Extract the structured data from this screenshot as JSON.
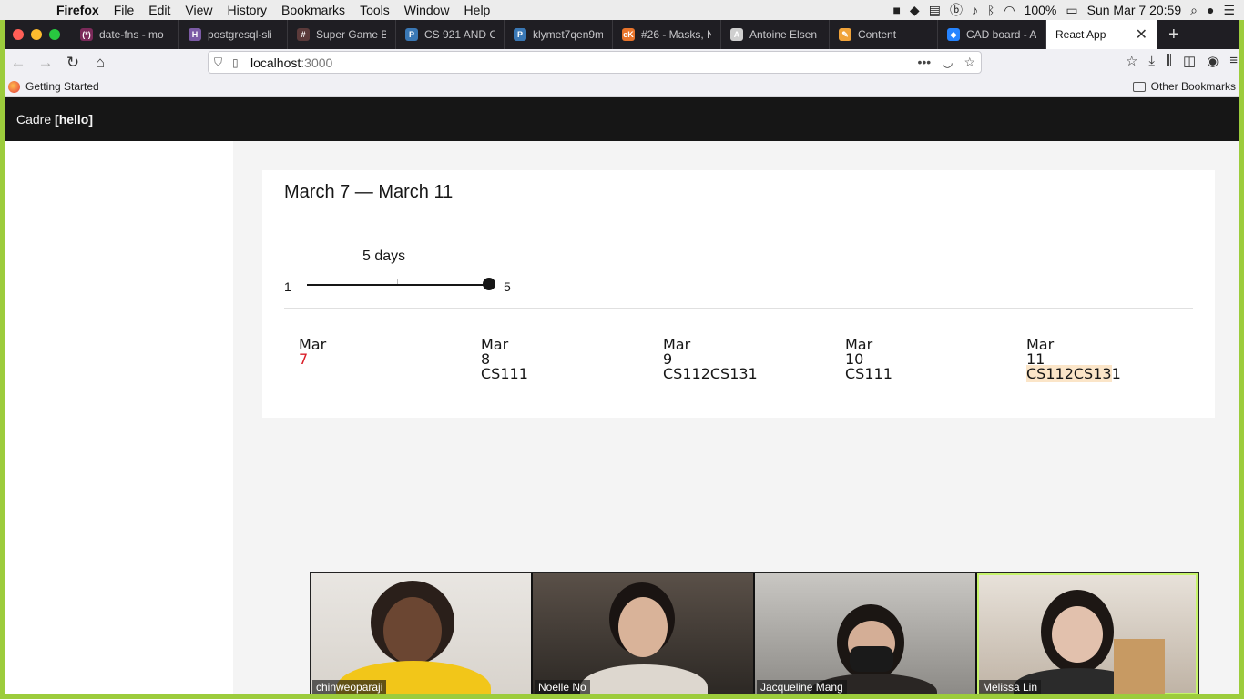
{
  "menubar": {
    "items": [
      "Firefox",
      "File",
      "Edit",
      "View",
      "History",
      "Bookmarks",
      "Tools",
      "Window",
      "Help"
    ],
    "battery": "100%",
    "clock": "Sun Mar 7  20:59"
  },
  "tabs": [
    {
      "label": "date-fns - mo",
      "icon": "date-fns-icon",
      "color": "#7b2a5a",
      "glyph": "(*)"
    },
    {
      "label": "postgresql-sli",
      "icon": "heroku-icon",
      "color": "#7c5ba6",
      "glyph": "H"
    },
    {
      "label": "Super Game B",
      "icon": "game-icon",
      "color": "#5b3a3a",
      "glyph": "#"
    },
    {
      "label": "CS 921 AND C",
      "icon": "piazza-icon",
      "color": "#3a78b5",
      "glyph": "P"
    },
    {
      "label": "klymet7qen9m",
      "icon": "piazza-icon",
      "color": "#3a78b5",
      "glyph": "P"
    },
    {
      "label": "#26 - Masks, N",
      "icon": "tab-orange-icon",
      "color": "#e8742b",
      "glyph": "eK"
    },
    {
      "label": "Antoine Elsen",
      "icon": "profile-icon",
      "color": "#cfcfcf",
      "glyph": "A"
    },
    {
      "label": "Content",
      "icon": "pencil-icon",
      "color": "#f0a33a",
      "glyph": "✎"
    },
    {
      "label": "CAD board - A",
      "icon": "jira-icon",
      "color": "#2684ff",
      "glyph": "◆"
    }
  ],
  "active_tab": {
    "label": "React App"
  },
  "url": {
    "host": "localhost",
    "port": ":3000"
  },
  "bookmarks": {
    "getting_started": "Getting Started",
    "other": "Other Bookmarks"
  },
  "app": {
    "brand": "Cadre",
    "brand_bold": "[hello]",
    "title": "March 7 — March 11",
    "slider": {
      "label": "5 days",
      "min": "1",
      "max": "5",
      "value": 5
    },
    "days": [
      {
        "month": "Mar",
        "num": "7",
        "courses": "",
        "today": true
      },
      {
        "month": "Mar",
        "num": "8",
        "courses": "CS111"
      },
      {
        "month": "Mar",
        "num": "9",
        "courses": "CS112CS131"
      },
      {
        "month": "Mar",
        "num": "10",
        "courses": "CS111"
      },
      {
        "month": "Mar",
        "num": "11",
        "courses_hl": "CS112CS13",
        "courses_rest": "1"
      }
    ]
  },
  "video": {
    "participants": [
      "chinweoparaji",
      "Noelle No",
      "Jacqueline Mang",
      "Melissa Lin"
    ]
  },
  "colors": {
    "accent_green": "#9ccc3c",
    "header_bg": "#161616",
    "today_red": "#da1e28",
    "highlight": "#fbe5c8"
  }
}
